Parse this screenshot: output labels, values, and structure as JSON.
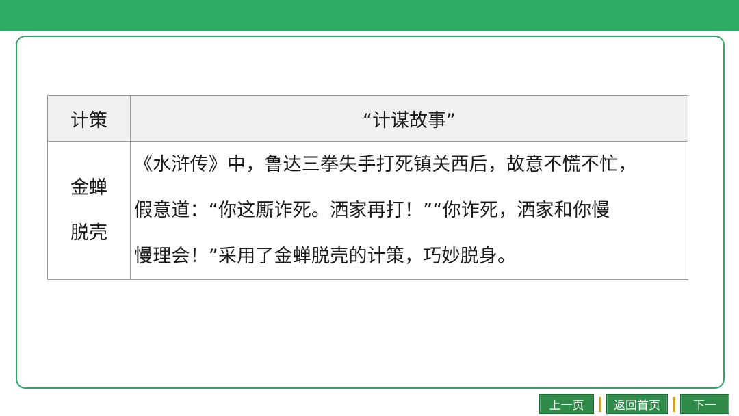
{
  "table": {
    "header": {
      "col1": "计策",
      "col2": "“计谋故事”"
    },
    "row": {
      "name_line1": "金蝉",
      "name_line2": "脱壳",
      "story_line1": "《水浒传》中，鲁达三拳失手打死镇关西后，故意不慌不忙，",
      "story_line2": "假意道：“你这厮诈死。洒家再打！”“你诈死，洒家和你慢",
      "story_line3": "慢理会！”采用了金蝉脱壳的计策，巧妙脱身。"
    }
  },
  "nav": {
    "prev_label": "上一页",
    "home_label": "返回首页",
    "next_label": "下一"
  },
  "colors": {
    "accent": "#2eaa62",
    "nav_button": "#2f8a4a",
    "nav_separator": "#c9a227",
    "header_bg": "#f0f0f0"
  }
}
